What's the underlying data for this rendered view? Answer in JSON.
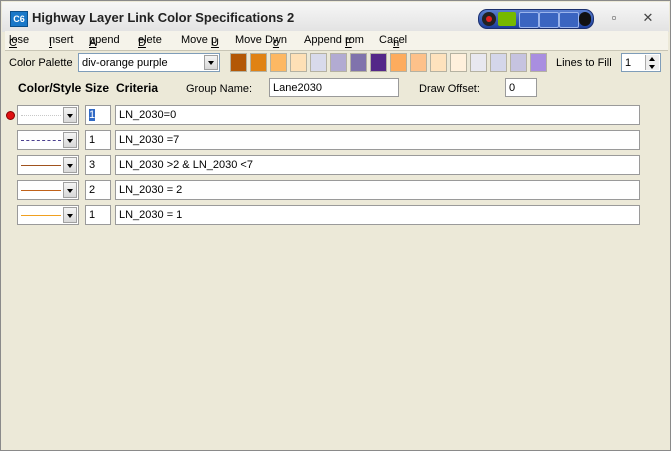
{
  "window": {
    "title": "Highway Layer Link Color Specifications 2",
    "app_icon": "C6",
    "controls": [
      "restore-icon",
      "close-icon"
    ]
  },
  "menu": [
    {
      "label": "Close",
      "mnemonic": "C"
    },
    {
      "label": "Insert",
      "mnemonic": "I"
    },
    {
      "label": "Append",
      "mnemonic": "A"
    },
    {
      "label": "Delete",
      "mnemonic": "D"
    },
    {
      "label": "Move Up",
      "mnemonic": "U"
    },
    {
      "label": "Move Down",
      "mnemonic": "D"
    },
    {
      "label": "Append From",
      "mnemonic": "F"
    },
    {
      "label": "Cancel",
      "mnemonic": "n"
    }
  ],
  "toolbar": {
    "palette_label": "Color Palette",
    "palette_value": "div-orange purple",
    "swatches": [
      "#b35806",
      "#e08214",
      "#fdb863",
      "#fee0b6",
      "#d8daeb",
      "#b2abd2",
      "#8073ac",
      "#542788",
      "#fdac5e",
      "#fdc18a",
      "#fee2bd",
      "#fff0dc",
      "#e8e8f0",
      "#d4d6ea",
      "#c6c3e0",
      "#a98ee0"
    ],
    "lines_label": "Lines to Fill",
    "lines_value": "1"
  },
  "headers": {
    "color_style": "Color/Style",
    "size": "Size",
    "criteria": "Criteria",
    "group_name_label": "Group Name:",
    "group_name_value": "Lane2030",
    "draw_offset_label": "Draw Offset:",
    "draw_offset_value": "0"
  },
  "rows": [
    {
      "size": "1",
      "criteria": "LN_2030=0",
      "line_color": "#ffffff",
      "line_style": "dotted",
      "selected": true
    },
    {
      "size": "1",
      "criteria": "LN_2030 =7",
      "line_color": "#4b3f8f",
      "line_style": "dashed"
    },
    {
      "size": "3",
      "criteria": "LN_2030 >2  & LN_2030 <7",
      "line_color": "#a0521e",
      "line_style": "solid"
    },
    {
      "size": "2",
      "criteria": "LN_2030 = 2",
      "line_color": "#c0621a",
      "line_style": "solid"
    },
    {
      "size": "1",
      "criteria": "LN_2030 = 1",
      "line_color": "#f0a020",
      "line_style": "solid"
    }
  ]
}
